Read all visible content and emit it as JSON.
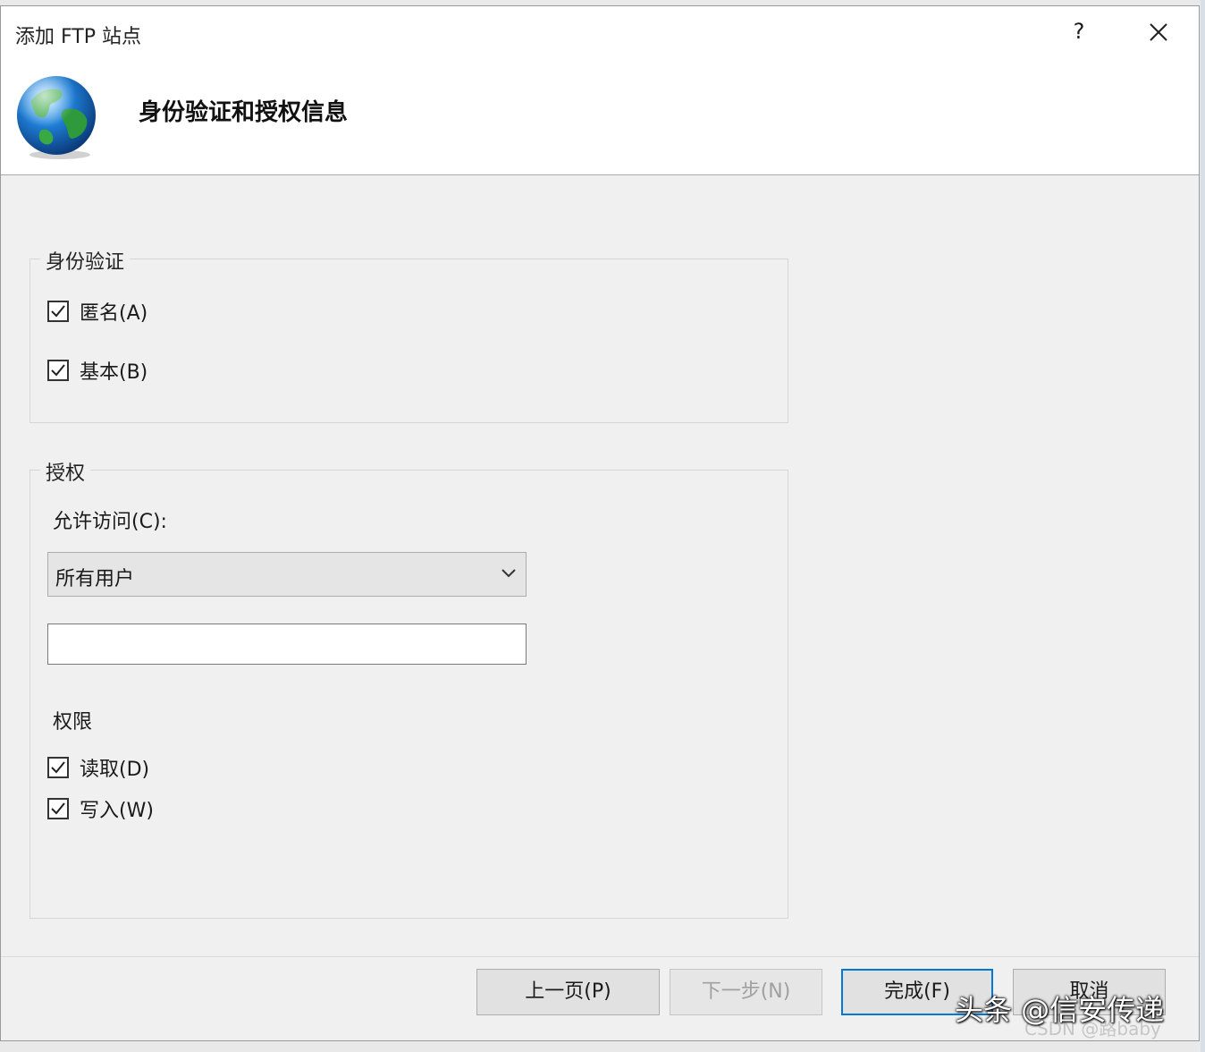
{
  "window": {
    "title": "添加 FTP 站点",
    "help_label": "?"
  },
  "header": {
    "heading": "身份验证和授权信息",
    "icon": "globe-icon"
  },
  "authentication": {
    "legend": "身份验证",
    "anonymous": {
      "label": "匿名(A)",
      "checked": true
    },
    "basic": {
      "label": "基本(B)",
      "checked": true
    }
  },
  "authorization": {
    "legend": "授权",
    "allow_access_label": "允许访问(C):",
    "allow_access_value": "所有用户",
    "user_input_value": "",
    "permissions_label": "权限",
    "read": {
      "label": "读取(D)",
      "checked": true
    },
    "write": {
      "label": "写入(W)",
      "checked": true
    }
  },
  "buttons": {
    "previous": "上一页(P)",
    "next": "下一步(N)",
    "finish": "完成(F)",
    "cancel": "取消"
  },
  "watermark": {
    "main": "头条 @信安传递",
    "sub": "CSDN @路baby"
  },
  "colors": {
    "accent": "#0078d7",
    "dialog_bg": "#f0f0f0",
    "header_bg": "#ffffff"
  }
}
